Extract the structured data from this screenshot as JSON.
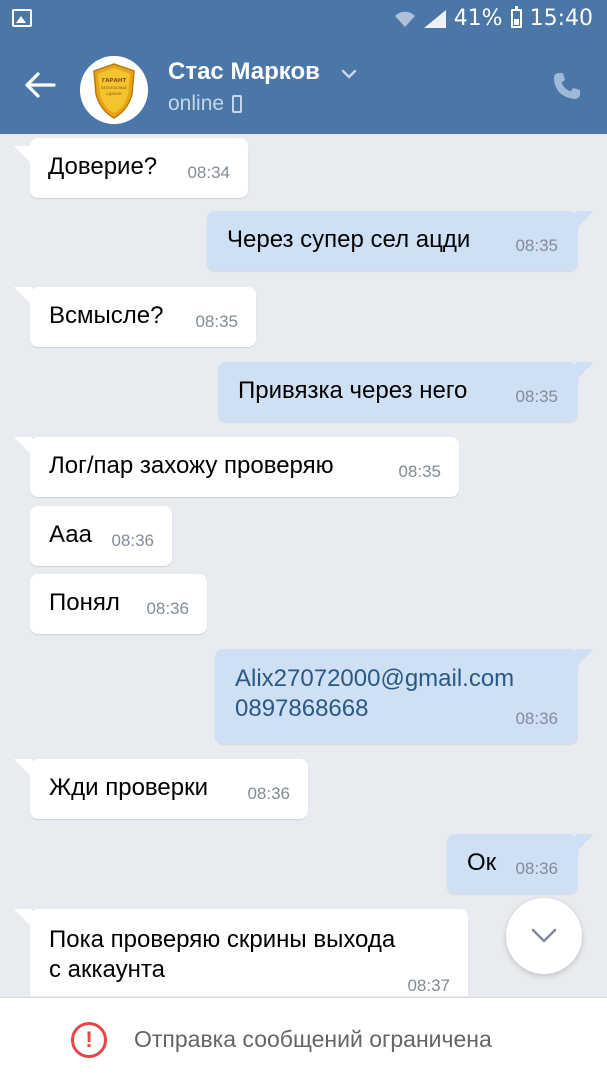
{
  "status_bar": {
    "battery": "41%",
    "time": "15:40",
    "icons": [
      "gallery-icon",
      "wifi-icon",
      "signal-icon",
      "battery-icon"
    ]
  },
  "header": {
    "contact_name": "Стас Марков",
    "status": "online",
    "avatar_text": [
      "ГАРАНТ",
      "БЕЗОПАСНЫХ",
      "СДЕЛОК"
    ],
    "icons": [
      "back-arrow-icon",
      "chevron-down-icon",
      "mobile-icon",
      "phone-icon"
    ]
  },
  "messages": [
    {
      "dir": "in",
      "text": "Доверие?",
      "time": "08:34"
    },
    {
      "dir": "out",
      "text": "Через супер сел ацди",
      "time": "08:35"
    },
    {
      "dir": "in",
      "text": "Всмысле?",
      "time": "08:35"
    },
    {
      "dir": "out",
      "text": "Привязка через него",
      "time": "08:35"
    },
    {
      "dir": "in",
      "text": "Лог/пар захожу проверяю",
      "time": "08:35"
    },
    {
      "dir": "in",
      "text": "Ааа",
      "time": "08:36"
    },
    {
      "dir": "in",
      "text": "Понял",
      "time": "08:36"
    },
    {
      "dir": "out",
      "text_line1": "Alix27072000@gmail.com",
      "text_line2": "0897868668",
      "time": "08:36"
    },
    {
      "dir": "in",
      "text": "Жди проверки",
      "time": "08:36"
    },
    {
      "dir": "out",
      "text": "Ок",
      "time": "08:36"
    },
    {
      "dir": "in",
      "text_line1": "Пока проверяю скрины выхода",
      "text_line2": "с аккаунта",
      "time": "08:37"
    }
  ],
  "footer": {
    "notice": "Отправка сообщений ограничена",
    "icon": "warning-icon"
  },
  "colors": {
    "header_bg": "#4a76a8",
    "chat_bg": "#e8ecf1",
    "outgoing_bubble": "#cfe0f5",
    "incoming_bubble": "#ffffff",
    "link": "#2a5885",
    "warning": "#e64646"
  }
}
